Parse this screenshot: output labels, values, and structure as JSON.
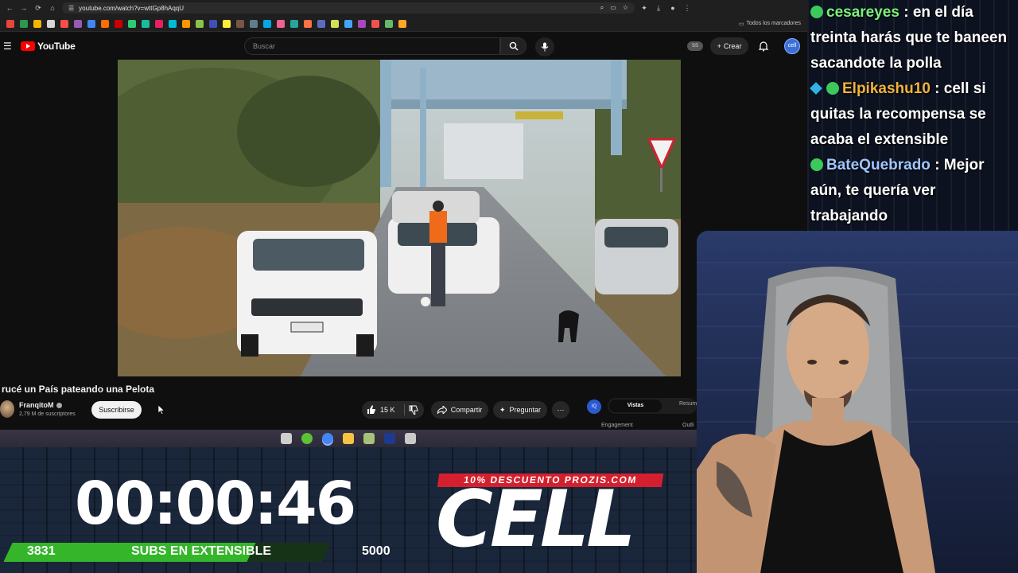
{
  "browser": {
    "url": "youtube.com/watch?v=wttGp8hAqqU",
    "bookmarks_folder": "Todos los marcadores",
    "bookmark_colors": [
      "#e8453c",
      "#2b9a4b",
      "#f5b400",
      "#d6d6d6",
      "#ff4e45",
      "#9b59b6",
      "#4285f4",
      "#ff6d00",
      "#cc0000",
      "#2ecc71",
      "#1abc9c",
      "#e91e63",
      "#00bcd4",
      "#ff9800",
      "#8bc34a",
      "#3f51b5",
      "#ffeb3b",
      "#795548",
      "#607d8b",
      "#00a8e8",
      "#f06292",
      "#26a69a",
      "#ff7043",
      "#5c6bc0",
      "#d4e157",
      "#42a5f5",
      "#ab47bc",
      "#ef5350",
      "#66bb6a",
      "#ffa726"
    ]
  },
  "youtube": {
    "logo_text": "YouTube",
    "search_placeholder": "Buscar",
    "ss_badge": "SS",
    "create_label": "Crear",
    "avatar_label": "cell",
    "video": {
      "title": "rucé un País pateando una Pelota",
      "channel_name": "FranqitoM",
      "subscribers": "2,79 M de suscriptores",
      "subscribe_label": "Suscribirse",
      "likes": "15 K",
      "share_label": "Compartir",
      "ask_label": "Preguntar"
    },
    "extension": {
      "logo": "IQ",
      "tab_active": "Vistas",
      "tab_other": "Resum",
      "label_engagement": "Engagement",
      "label_outlier": "Outli"
    }
  },
  "overlay": {
    "timer": "00:00:46",
    "subs_current": "3831",
    "subs_label": "SUBS EN EXTENSIBLE",
    "subs_goal": "5000",
    "subs_progress": 0.766,
    "promo": "10% DESCUENTO PROZIS.COM",
    "brand": "CELL",
    "accent_green": "#34b52a",
    "accent_red": "#d4202e"
  },
  "chat": [
    {
      "user": "cesareyes",
      "user_color": "#7cf07c",
      "badges": [
        "badge-icon"
      ],
      "message": " : en el día treinta harás que te baneen sacandote la polla"
    },
    {
      "user": "Elpikashu10",
      "user_color": "#f0b43c",
      "badges": [
        "cube-icon",
        "badge-icon"
      ],
      "message": " : cell si quitas la recompensa se acaba el extensible"
    },
    {
      "user": "BateQuebrado",
      "user_color": "#9ec6ff",
      "badges": [
        "badge-icon"
      ],
      "message": " : Mejor aún, te quería ver trabajando"
    }
  ],
  "taskbar": {
    "icon_colors": [
      "#cfcfcf",
      "#5bc236",
      "#4285f4",
      "#f6c343",
      "#a6c17a",
      "#1c3b8f",
      "#c9c9c9"
    ]
  }
}
